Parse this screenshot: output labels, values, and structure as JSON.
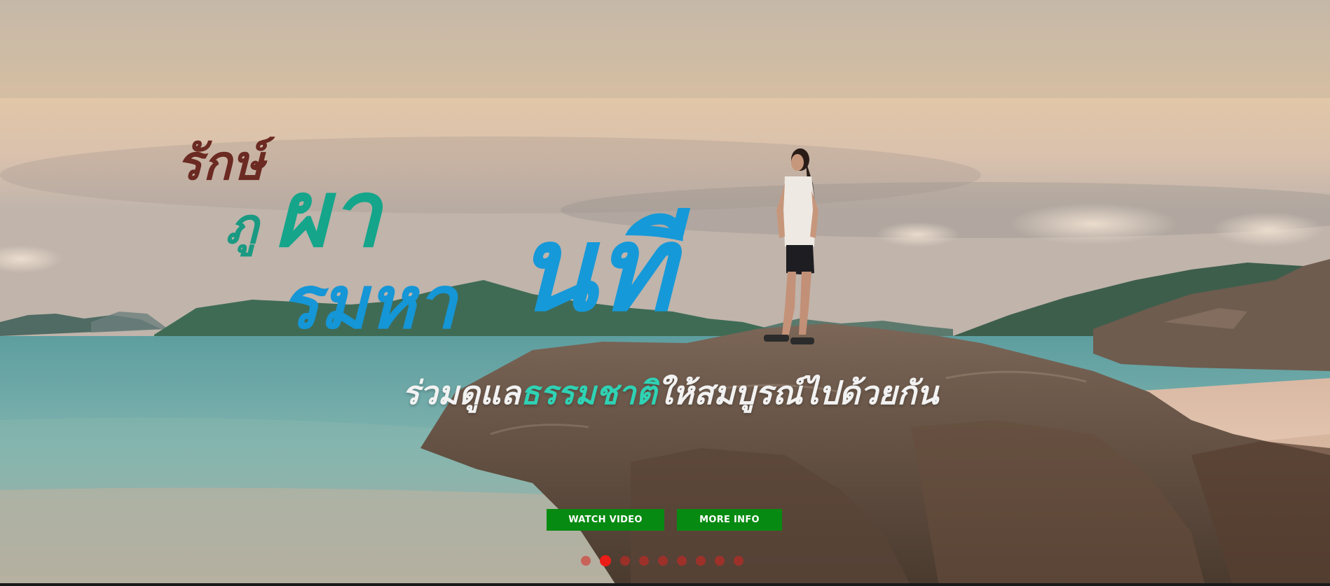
{
  "hero": {
    "title_line1": "รักษ์",
    "title_line2_small": "ภู",
    "title_line2_big": "ผา",
    "title_line3_small": "รมหา",
    "title_line3_big": "นที",
    "tagline_part1": "ร่วมดูแล",
    "tagline_part2": "ธรรมชาติ",
    "tagline_part3": "ให้สมบูรณ์ไปด้วยกัน",
    "colors": {
      "title_brown": "#6b2a22",
      "title_green": "#14a58b",
      "title_blue": "#1599d9",
      "tagline_accent": "#2fd2b4",
      "button_green": "#078a11",
      "dot_red": "#ec1c16"
    }
  },
  "actions": {
    "watch_video_label": "WATCH VIDEO",
    "more_info_label": "MORE INFO"
  },
  "carousel": {
    "slide_count": 9,
    "active_index": 1
  }
}
